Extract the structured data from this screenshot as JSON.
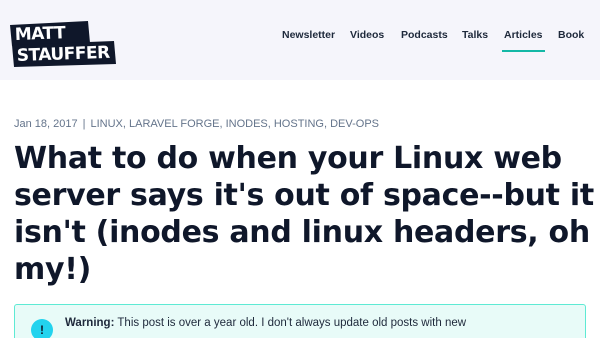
{
  "brand": {
    "line1": "MATT",
    "line2": "STAUFFER"
  },
  "nav": {
    "items": [
      {
        "label": "Newsletter"
      },
      {
        "label": "Videos"
      },
      {
        "label": "Podcasts"
      },
      {
        "label": "Talks"
      },
      {
        "label": "Articles",
        "active": true
      },
      {
        "label": "Book"
      }
    ]
  },
  "post": {
    "date": "Jan 18, 2017",
    "separator": "|",
    "tags": "LINUX, LARAVEL FORGE, INODES, HOSTING, DEV-OPS",
    "title": "What to do when your Linux web server says it's out of space--but it isn't (inodes and linux headers, oh my!)"
  },
  "warning": {
    "icon": "info-icon",
    "icon_glyph": "!",
    "label": "Warning:",
    "text": " This post is over a year old. I don't always update old posts with new"
  },
  "colors": {
    "header_bg": "#f5f5fb",
    "accent": "#14b8a6",
    "callout_bg": "#e8fbf8",
    "callout_border": "#5eead4",
    "icon_bg": "#22d3ee"
  }
}
